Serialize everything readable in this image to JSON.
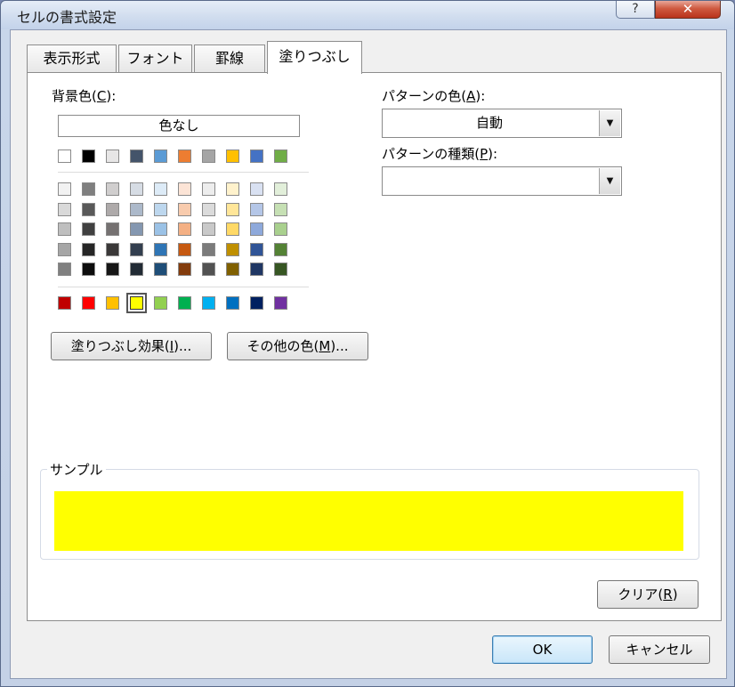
{
  "window": {
    "title": "セルの書式設定",
    "help_label": "?",
    "close_label": "✕"
  },
  "tabs": [
    {
      "label": "表示形式",
      "active": false
    },
    {
      "label": "フォント",
      "active": false
    },
    {
      "label": "罫線",
      "active": false
    },
    {
      "label": "塗りつぶし",
      "active": true
    }
  ],
  "background": {
    "label_pre": "背景色(",
    "label_key": "C",
    "label_post": "):",
    "no_color_label": "色なし",
    "selected_color": "#FFFF00",
    "theme_row": [
      "#FFFFFF",
      "#000000",
      "#E7E6E6",
      "#44546A",
      "#5B9BD5",
      "#ED7D31",
      "#A5A5A5",
      "#FFC000",
      "#4472C4",
      "#70AD47"
    ],
    "tint_rows": [
      [
        "#F2F2F2",
        "#7F7F7F",
        "#D0CECE",
        "#D6DCE4",
        "#DDEBF7",
        "#FCE4D6",
        "#EDEDED",
        "#FFF2CC",
        "#D9E1F2",
        "#E2EFDA"
      ],
      [
        "#D9D9D9",
        "#595959",
        "#AEAAAA",
        "#ACB9CA",
        "#BDD7EE",
        "#F8CBAD",
        "#DBDBDB",
        "#FFE699",
        "#B4C6E7",
        "#C6E0B4"
      ],
      [
        "#BFBFBF",
        "#404040",
        "#757171",
        "#8497B0",
        "#9BC2E6",
        "#F4B084",
        "#C9C9C9",
        "#FFD966",
        "#8EA9DB",
        "#A9D08E"
      ],
      [
        "#A6A6A6",
        "#262626",
        "#3A3838",
        "#333F4F",
        "#2F75B5",
        "#C65911",
        "#7B7B7B",
        "#BF8F00",
        "#305496",
        "#548235"
      ],
      [
        "#808080",
        "#0D0D0D",
        "#161616",
        "#222B35",
        "#1F4E78",
        "#833C0C",
        "#525252",
        "#806000",
        "#203764",
        "#375623"
      ]
    ],
    "standard_row": [
      "#C00000",
      "#FF0000",
      "#FFC000",
      "#FFFF00",
      "#92D050",
      "#00B050",
      "#00B0F0",
      "#0070C0",
      "#002060",
      "#7030A0"
    ],
    "fill_effects": {
      "pre": "塗りつぶし効果(",
      "key": "I",
      "post": ")..."
    },
    "more_colors": {
      "pre": "その他の色(",
      "key": "M",
      "post": ")..."
    }
  },
  "pattern": {
    "color_label_pre": "パターンの色(",
    "color_label_key": "A",
    "color_label_post": "):",
    "color_value": "自動",
    "type_label_pre": "パターンの種類(",
    "type_label_key": "P",
    "type_label_post": "):",
    "type_value": "",
    "arrow_glyph": "▼"
  },
  "sample": {
    "label": "サンプル",
    "color": "#FFFF00"
  },
  "clear": {
    "pre": "クリア(",
    "key": "R",
    "post": ")"
  },
  "ok_label": "OK",
  "cancel_label": "キャンセル"
}
